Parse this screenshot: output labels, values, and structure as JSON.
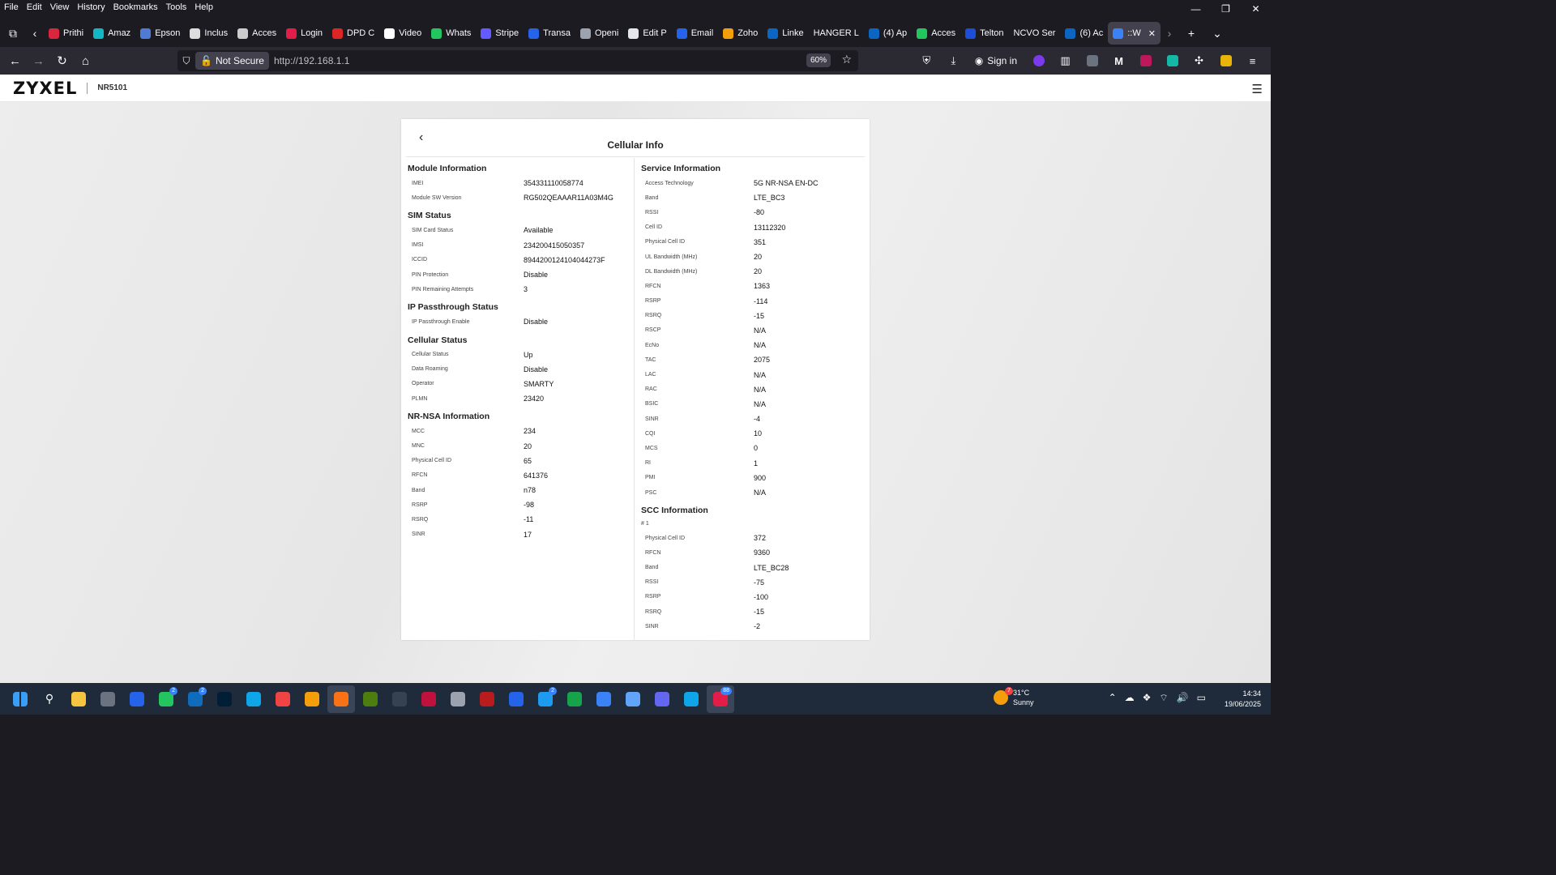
{
  "browser": {
    "menu": [
      "File",
      "Edit",
      "View",
      "History",
      "Bookmarks",
      "Tools",
      "Help"
    ],
    "window_controls": {
      "minimize": "—",
      "restore": "❐",
      "close": "✕"
    },
    "tabs": [
      {
        "label": "Prithi",
        "color": "#d7263d"
      },
      {
        "label": "Amaz",
        "color": "#14b8c4"
      },
      {
        "label": "Epson",
        "color": "#4f7ad6"
      },
      {
        "label": "Inclus",
        "color": "#dddddd"
      },
      {
        "label": "Acces",
        "color": "#cccccc"
      },
      {
        "label": "Login",
        "color": "#e11d48"
      },
      {
        "label": "DPD C",
        "color": "#dc2626"
      },
      {
        "label": "Video",
        "color": "#ffffff"
      },
      {
        "label": "Whats",
        "color": "#22c55e"
      },
      {
        "label": "Stripe",
        "color": "#635bff"
      },
      {
        "label": "Transa",
        "color": "#2563eb"
      },
      {
        "label": "Openi",
        "color": "#9ca3af"
      },
      {
        "label": "Edit P",
        "color": "#e5e7eb"
      },
      {
        "label": "Email",
        "color": "#2563eb"
      },
      {
        "label": "Zoho",
        "color": "#f59e0b"
      },
      {
        "label": "Linke",
        "color": "#0a66c2"
      },
      {
        "label": "HANGER L",
        "color": ""
      },
      {
        "label": "(4) Ap",
        "color": "#0a66c2"
      },
      {
        "label": "Acces",
        "color": "#22c55e"
      },
      {
        "label": "Telton",
        "color": "#1d4ed8"
      },
      {
        "label": "NCVO Ser",
        "color": ""
      },
      {
        "label": "(6) Ac",
        "color": "#0a66c2"
      },
      {
        "label": "::W",
        "color": "#3b82f6",
        "active": true
      }
    ],
    "url_security": "Not Secure",
    "url": "http://192.168.1.1",
    "zoom": "60%",
    "sign_in": "Sign in"
  },
  "router": {
    "brand": "ZYXEL",
    "model": "NR5101",
    "title": "Cellular Info",
    "left_sections": [
      {
        "title": "Module Information",
        "rows": [
          {
            "label": "IMEI",
            "value": "354331110058774"
          },
          {
            "label": "Module SW Version",
            "value": "RG502QEAAAR11A03M4G"
          }
        ]
      },
      {
        "title": "SIM Status",
        "rows": [
          {
            "label": "SIM Card Status",
            "value": "Available"
          },
          {
            "label": "IMSI",
            "value": "234200415050357"
          },
          {
            "label": "ICCID",
            "value": "8944200124104044273F"
          },
          {
            "label": "PIN Protection",
            "value": "Disable"
          },
          {
            "label": "PIN Remaining Attempts",
            "value": "3"
          }
        ]
      },
      {
        "title": "IP Passthrough Status",
        "rows": [
          {
            "label": "IP Passthrough Enable",
            "value": "Disable"
          }
        ]
      },
      {
        "title": "Cellular Status",
        "rows": [
          {
            "label": "Cellular Status",
            "value": "Up"
          },
          {
            "label": "Data Roaming",
            "value": "Disable"
          },
          {
            "label": "Operator",
            "value": "SMARTY"
          },
          {
            "label": "PLMN",
            "value": "23420"
          }
        ]
      },
      {
        "title": "NR-NSA Information",
        "rows": [
          {
            "label": "MCC",
            "value": "234"
          },
          {
            "label": "MNC",
            "value": "20"
          },
          {
            "label": "Physical Cell ID",
            "value": "65"
          },
          {
            "label": "RFCN",
            "value": "641376"
          },
          {
            "label": "Band",
            "value": "n78"
          },
          {
            "label": "RSRP",
            "value": "-98"
          },
          {
            "label": "RSRQ",
            "value": "-11"
          },
          {
            "label": "SINR",
            "value": "17"
          }
        ]
      }
    ],
    "service": {
      "title": "Service Information",
      "rows": [
        {
          "label": "Access Technology",
          "value": "5G NR-NSA EN-DC"
        },
        {
          "label": "Band",
          "value": "LTE_BC3"
        },
        {
          "label": "RSSI",
          "value": "-80"
        },
        {
          "label": "Cell ID",
          "value": "13112320"
        },
        {
          "label": "Physical Cell ID",
          "value": "351"
        },
        {
          "label": "UL Bandwidth (MHz)",
          "value": "20"
        },
        {
          "label": "DL Bandwidth (MHz)",
          "value": "20"
        },
        {
          "label": "RFCN",
          "value": "1363"
        },
        {
          "label": "RSRP",
          "value": "-114"
        },
        {
          "label": "RSRQ",
          "value": "-15"
        },
        {
          "label": "RSCP",
          "value": "N/A"
        },
        {
          "label": "EcNo",
          "value": "N/A"
        },
        {
          "label": "TAC",
          "value": "2075"
        },
        {
          "label": "LAC",
          "value": "N/A"
        },
        {
          "label": "RAC",
          "value": "N/A"
        },
        {
          "label": "BSIC",
          "value": "N/A"
        },
        {
          "label": "SINR",
          "value": "-4"
        },
        {
          "label": "CQI",
          "value": "10"
        },
        {
          "label": "MCS",
          "value": "0"
        },
        {
          "label": "RI",
          "value": "1"
        },
        {
          "label": "PMI",
          "value": "900"
        },
        {
          "label": "PSC",
          "value": "N/A"
        }
      ]
    },
    "scc": {
      "title": "SCC Information",
      "index_label": "# 1",
      "rows": [
        {
          "label": "Physical Cell ID",
          "value": "372"
        },
        {
          "label": "RFCN",
          "value": "9360"
        },
        {
          "label": "Band",
          "value": "LTE_BC28"
        },
        {
          "label": "RSSI",
          "value": "-75"
        },
        {
          "label": "RSRP",
          "value": "-100"
        },
        {
          "label": "RSRQ",
          "value": "-15"
        },
        {
          "label": "SINR",
          "value": "-2"
        }
      ]
    }
  },
  "taskbar": {
    "apps": [
      {
        "name": "start",
        "color": "#3b9ef5"
      },
      {
        "name": "search",
        "color": ""
      },
      {
        "name": "file-explorer",
        "color": "#f5c542"
      },
      {
        "name": "calculator",
        "color": "#6b7280"
      },
      {
        "name": "messenger",
        "color": "#2563eb"
      },
      {
        "name": "whatsapp",
        "color": "#22c55e",
        "badge": "2"
      },
      {
        "name": "outlook",
        "color": "#0f6cbd",
        "badge": "2"
      },
      {
        "name": "photoshop",
        "color": "#001e36"
      },
      {
        "name": "edge",
        "color": "#0ea5e9"
      },
      {
        "name": "chrome-alt",
        "color": "#ef4444"
      },
      {
        "name": "chrome",
        "color": "#f59e0b"
      },
      {
        "name": "firefox",
        "color": "#f97316",
        "active": true
      },
      {
        "name": "dreamweaver",
        "color": "#4d7c0f"
      },
      {
        "name": "settings",
        "color": "#374151"
      },
      {
        "name": "media-player",
        "color": "#be123c"
      },
      {
        "name": "notepad",
        "color": "#9ca3af"
      },
      {
        "name": "filezilla",
        "color": "#b91c1c"
      },
      {
        "name": "outlook-new",
        "color": "#2563eb"
      },
      {
        "name": "twitter",
        "color": "#1d9bf0",
        "badge": "2"
      },
      {
        "name": "excel",
        "color": "#16a34a"
      },
      {
        "name": "remote-desktop",
        "color": "#3b82f6"
      },
      {
        "name": "calendar",
        "color": "#60a5fa"
      },
      {
        "name": "teams",
        "color": "#6366f1"
      },
      {
        "name": "cortana",
        "color": "#0ea5e9"
      },
      {
        "name": "mail",
        "color": "#e11d48",
        "badge": "88",
        "active": true
      }
    ],
    "weather": {
      "temp": "31°C",
      "condition": "Sunny",
      "badge": "7"
    },
    "time": "14:34",
    "date": "19/06/2025"
  }
}
